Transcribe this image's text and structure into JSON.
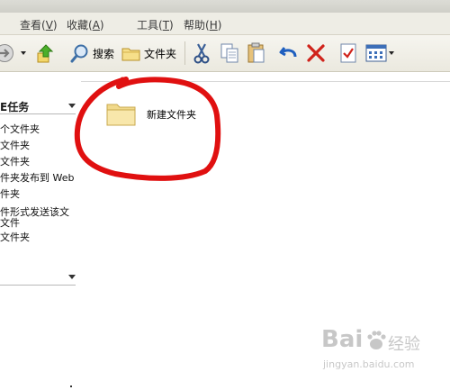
{
  "menu": [
    {
      "label": "查看(",
      "key": "V",
      "suffix": ")"
    },
    {
      "label": "收藏(",
      "key": "A",
      "suffix": ")"
    },
    {
      "label": "工具(",
      "key": "T",
      "suffix": ")"
    },
    {
      "label": "帮助(",
      "key": "H",
      "suffix": ")"
    }
  ],
  "toolbar": {
    "search_label": "搜索",
    "folders_label": "文件夹"
  },
  "task_pane": {
    "title": "E任务",
    "items": [
      "个文件夹",
      "文件夹",
      "文件夹",
      "件夹发布到 Web",
      "件夹",
      "件形式发送该文",
      "文件",
      "文件夹"
    ]
  },
  "files": [
    {
      "name": "新建文件夹",
      "icon": "folder-icon"
    }
  ],
  "watermark": {
    "brand": "Bai",
    "brand2": "经验",
    "url": "jingyan.baidu.com"
  },
  "colors": {
    "annotation_red": "#e01010",
    "folder_fill": "#f6e3a1"
  }
}
